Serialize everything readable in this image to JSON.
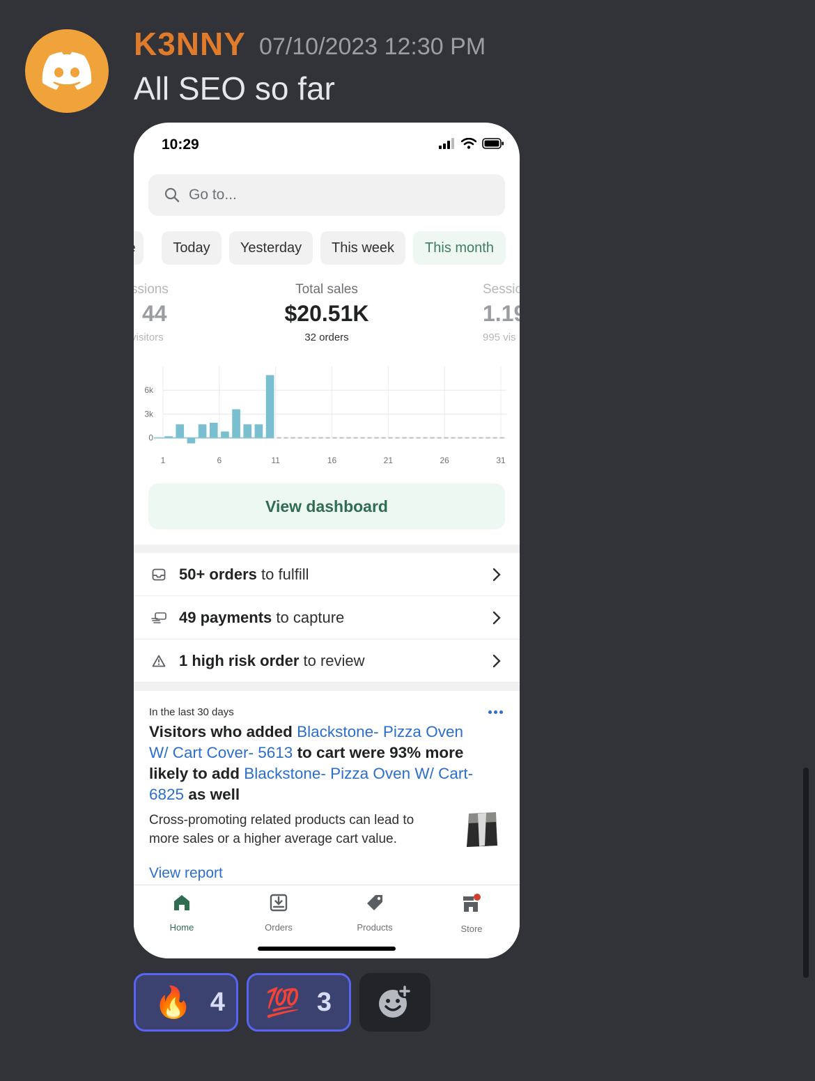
{
  "message": {
    "username": "K3NNY",
    "timestamp": "07/10/2023 12:30 PM",
    "text": "All SEO so far",
    "avatar_icon": "discord-logo-icon",
    "avatar_color": "#f0a23b"
  },
  "phone": {
    "status_time": "10:29",
    "search_placeholder": "Go to...",
    "chips": [
      {
        "label": "e"
      },
      {
        "label": "Today"
      },
      {
        "label": "Yesterday"
      },
      {
        "label": "This week"
      },
      {
        "label": "This month",
        "active": true
      }
    ],
    "metrics": {
      "left": {
        "label": "ssions",
        "value": "44",
        "sub": "visitors"
      },
      "center": {
        "label": "Total sales",
        "value": "$20.51K",
        "sub": "32 orders"
      },
      "right": {
        "label": "Sessic",
        "value": "1.19",
        "sub": "995 vis"
      }
    },
    "view_dashboard": "View dashboard",
    "tasks": [
      {
        "bold": "50+ orders",
        "rest": " to fulfill",
        "icon": "inbox-icon"
      },
      {
        "bold": "49 payments",
        "rest": " to capture",
        "icon": "payment-icon"
      },
      {
        "bold": "1 high risk order",
        "rest": " to review",
        "icon": "warning-icon"
      }
    ],
    "insight": {
      "label": "In the last 30 days",
      "t1": "Visitors who added ",
      "link1": "Blackstone- Pizza Oven W/ Cart Cover- 5613",
      "t2": " to cart were 93% more likely to add ",
      "link2": "Blackstone- Pizza Oven W/ Cart-6825",
      "t3": " as well",
      "description": "Cross-promoting related products can lead to more sales or a higher average cart value.",
      "action": "View report"
    },
    "tabs": [
      {
        "label": "Home",
        "icon": "home-icon",
        "active": true
      },
      {
        "label": "Orders",
        "icon": "orders-icon"
      },
      {
        "label": "Products",
        "icon": "tag-icon"
      },
      {
        "label": "Store",
        "icon": "store-icon"
      }
    ]
  },
  "chart_data": {
    "type": "bar",
    "x_ticks": [
      "1",
      "6",
      "11",
      "16",
      "21",
      "26",
      "31"
    ],
    "y_ticks": [
      "6k",
      "3k",
      "0"
    ],
    "ylim": [
      -1000,
      9000
    ],
    "days": [
      1,
      2,
      3,
      4,
      5,
      6,
      7,
      8,
      9,
      10
    ],
    "values": [
      200,
      1700,
      -700,
      1700,
      1900,
      800,
      3600,
      1700,
      1700,
      7900
    ],
    "bar_color": "#79bfcf",
    "xlim": [
      1,
      31
    ]
  },
  "reactions": [
    {
      "emoji": "🔥",
      "count": "4",
      "icon": "fire-emoji"
    },
    {
      "emoji": "💯",
      "count": "3",
      "icon": "hundred-emoji"
    }
  ],
  "add_reaction_icon": "add-reaction-icon"
}
